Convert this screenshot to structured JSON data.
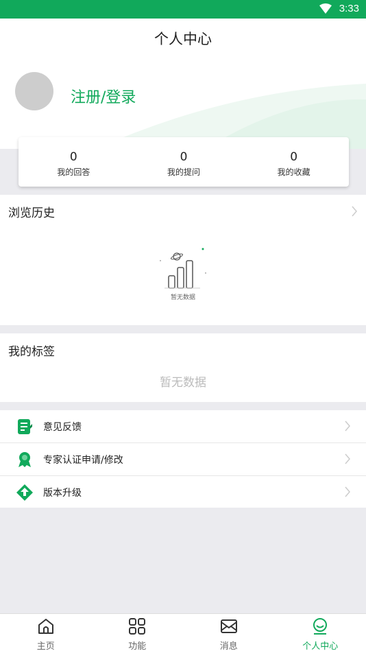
{
  "status_bar": {
    "time": "3:33"
  },
  "header": {
    "title": "个人中心",
    "login_label": "注册/登录"
  },
  "stats": [
    {
      "value": "0",
      "label": "我的回答"
    },
    {
      "value": "0",
      "label": "我的提问"
    },
    {
      "value": "0",
      "label": "我的收藏"
    }
  ],
  "history": {
    "title": "浏览历史",
    "empty_text": "暂无数据"
  },
  "tags": {
    "title": "我的标签",
    "empty_text": "暂无数据"
  },
  "menu": [
    {
      "label": "意见反馈",
      "icon": "feedback-icon"
    },
    {
      "label": "专家认证申请/修改",
      "icon": "expert-badge-icon"
    },
    {
      "label": "版本升级",
      "icon": "upgrade-icon"
    }
  ],
  "tabbar": [
    {
      "label": "主页",
      "icon": "home-icon"
    },
    {
      "label": "功能",
      "icon": "grid-icon"
    },
    {
      "label": "消息",
      "icon": "message-icon"
    },
    {
      "label": "个人中心",
      "icon": "profile-icon",
      "active": true
    }
  ],
  "colors": {
    "brand": "#11a95b",
    "background": "#ebebef"
  }
}
